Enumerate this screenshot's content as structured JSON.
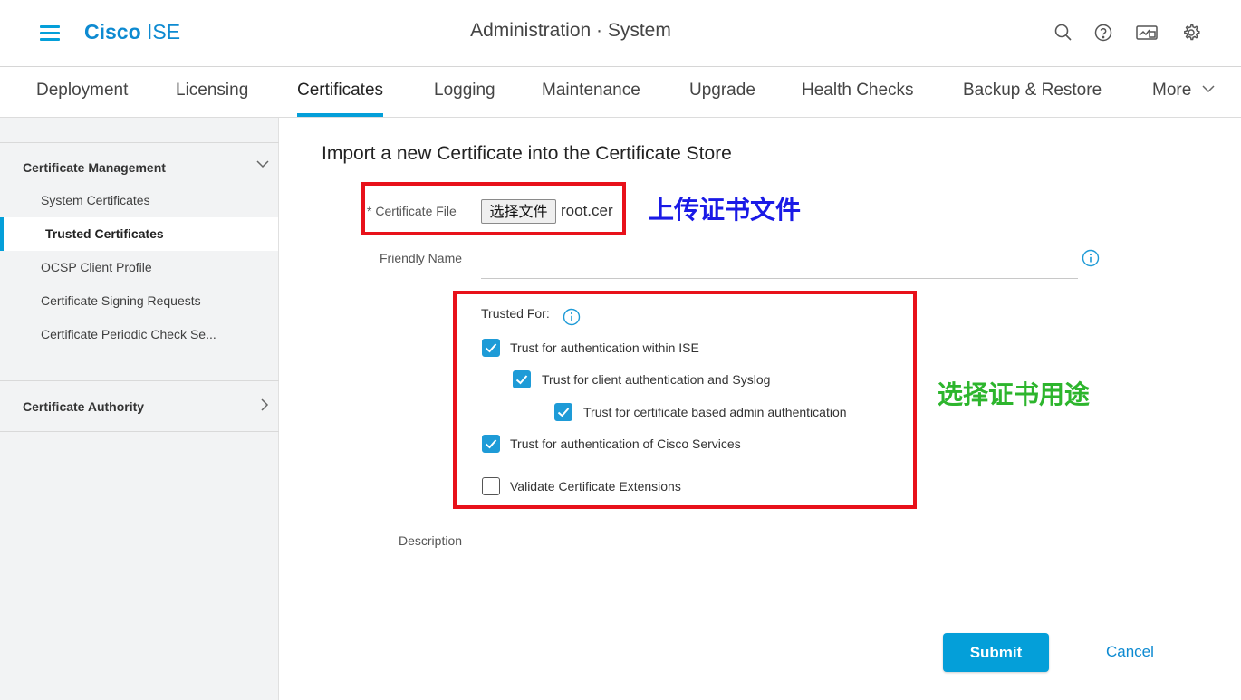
{
  "header": {
    "brand_bold": "Cisco",
    "brand_light": " ISE",
    "title": "Administration · System",
    "icons": [
      "search-icon",
      "help-icon",
      "dashboard-icon",
      "settings-icon"
    ]
  },
  "tabs": [
    {
      "label": "Deployment",
      "active": false
    },
    {
      "label": "Licensing",
      "active": false
    },
    {
      "label": "Certificates",
      "active": true
    },
    {
      "label": "Logging",
      "active": false
    },
    {
      "label": "Maintenance",
      "active": false
    },
    {
      "label": "Upgrade",
      "active": false
    },
    {
      "label": "Health Checks",
      "active": false
    },
    {
      "label": "Backup & Restore",
      "active": false
    },
    {
      "label": "More",
      "active": false
    }
  ],
  "sidebar": {
    "section1": "Certificate Management",
    "items": [
      {
        "label": "System Certificates",
        "active": false
      },
      {
        "label": "Trusted Certificates",
        "active": true
      },
      {
        "label": "OCSP Client Profile",
        "active": false
      },
      {
        "label": "Certificate Signing Requests",
        "active": false
      },
      {
        "label": "Certificate Periodic Check Se...",
        "active": false
      }
    ],
    "section2": "Certificate Authority"
  },
  "form": {
    "title": "Import a new Certificate into the Certificate Store",
    "cert_file_label": "* Certificate File",
    "choose_file_button": "选择文件",
    "chosen_file": "root.cer",
    "friendly_name_label": "Friendly Name",
    "friendly_name_value": "",
    "trusted_for_label": "Trusted For:",
    "checkboxes": [
      {
        "label": "Trust for authentication within ISE",
        "checked": true
      },
      {
        "label": "Trust for client authentication and Syslog",
        "checked": true
      },
      {
        "label": "Trust for certificate based admin authentication",
        "checked": true
      },
      {
        "label": "Trust for authentication of Cisco Services",
        "checked": true
      },
      {
        "label": "Validate Certificate Extensions",
        "checked": false
      }
    ],
    "description_label": "Description",
    "description_value": "",
    "submit_label": "Submit",
    "cancel_label": "Cancel"
  },
  "annotations": {
    "upload": {
      "text": "上传证书文件",
      "color": "#1a1ae6"
    },
    "purpose": {
      "text": "选择证书用途",
      "color": "#2db52d"
    }
  },
  "colors": {
    "accent": "#049fd9",
    "brand": "#0d8ad1",
    "highlight_box": "#e8111a"
  }
}
